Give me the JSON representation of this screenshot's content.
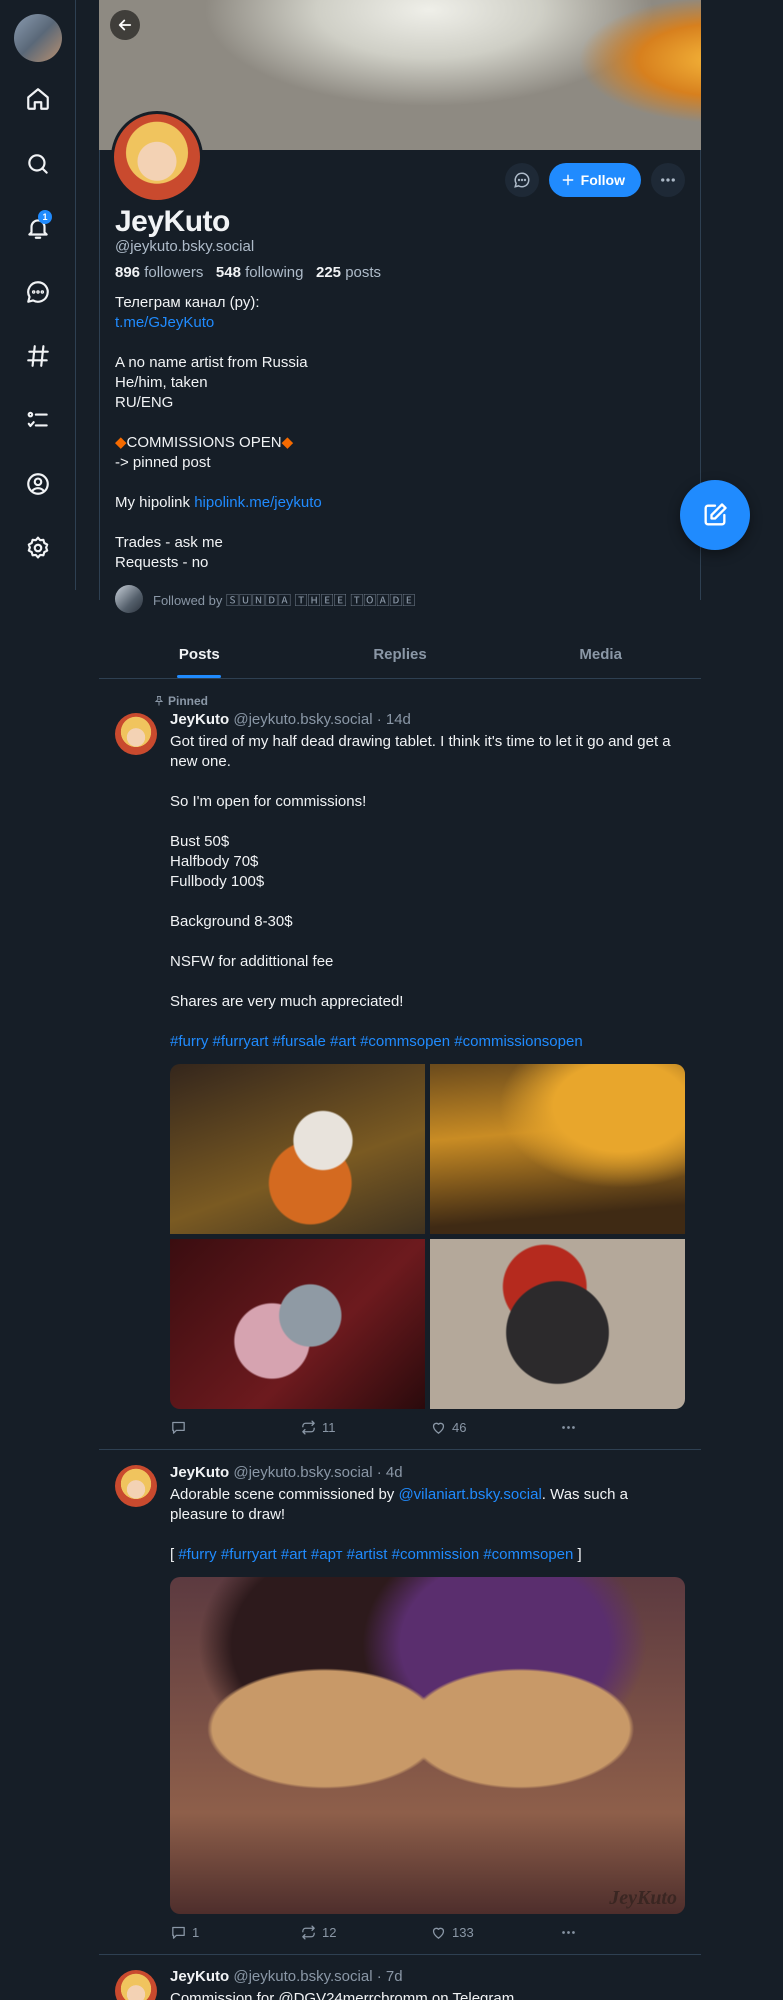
{
  "profile": {
    "display_name": "JeyKuto",
    "handle": "@jeykuto.bsky.social",
    "followers_count": "896",
    "followers_label": "followers",
    "following_count": "548",
    "following_label": "following",
    "posts_count": "225",
    "posts_label": "posts",
    "follow_label": "Follow",
    "bio_line1": "Телеграм канал (ру):",
    "bio_link1": "t.me/GJeyKuto",
    "bio_block2": "A no name artist from Russia\nHe/him, taken\nRU/ENG",
    "bio_commissions": "COMMISSIONS OPEN",
    "bio_pinned_hint": "-> pinned post",
    "bio_hipolink_prefix": "My hipolink ",
    "bio_hipolink": "hipolink.me/jeykuto",
    "bio_block3": "Trades - ask me\nRequests - no",
    "followed_by": "Followed by 🅂🅄🄽🄳🄰 🅃🄷🄴🄴 🅃🄾🄰🄳🄴"
  },
  "sidebar": {
    "notification_badge": "1",
    "icons": [
      "home-icon",
      "search-icon",
      "bell-icon",
      "chat-icon",
      "hashtag-icon",
      "list-icon",
      "profile-icon",
      "settings-icon"
    ]
  },
  "tabs": [
    "Posts",
    "Replies",
    "Media"
  ],
  "posts": [
    {
      "pinned_label": "Pinned",
      "author": "JeyKuto",
      "meta": "@jeykuto.bsky.social · 14d",
      "text": "Got tired of my half dead drawing tablet. I think it's time to let it go and get a new one.\n\nSo I'm open for commissions!\n\nBust 50$\nHalfbody 70$\nFullbody 100$\n\nBackground 8-30$\n\nNSFW for addittional fee\n\nShares are very much appreciated!",
      "tags": "#furry #furryart #fursale #art #commsopen #commissionsopen",
      "replies": "",
      "reposts": "11",
      "likes": "46"
    },
    {
      "author": "JeyKuto",
      "meta": "@jeykuto.bsky.social · 4d",
      "text_prefix": "Adorable scene commissioned by ",
      "mention": "@vilaniart.bsky.social",
      "text_suffix": ". Was such a pleasure to draw!",
      "tags_open": "[ ",
      "tags": "#furry #furryart #art #арт #artist #commission #commsopen",
      "tags_close": " ]",
      "watermark": "JeyKuto",
      "replies": "1",
      "reposts": "12",
      "likes": "133"
    },
    {
      "author": "JeyKuto",
      "meta": "@jeykuto.bsky.social · 7d",
      "text": "Commission for @DGV24merrcbromm on Telegram"
    }
  ],
  "colors": {
    "accent": "#208bfe",
    "background": "#161e27",
    "border": "#2e4052",
    "muted": "#8a97a6",
    "commission_diamond": "#f56a00"
  }
}
